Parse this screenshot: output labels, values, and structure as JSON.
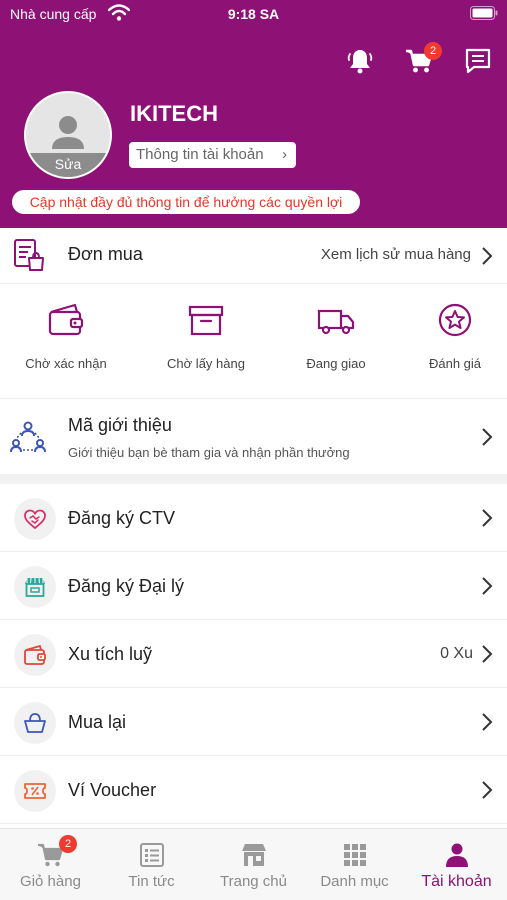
{
  "status_bar": {
    "carrier": "Nhà cung cấp",
    "time": "9:18 SA"
  },
  "header": {
    "icons": [
      "bell-icon",
      "cart-icon",
      "chat-icon"
    ],
    "cart_badge": "2",
    "user_name": "IKITECH",
    "avatar_edit_label": "Sửa",
    "account_info_label": "Thông tin tài khoản",
    "update_notice": "Cập nhật đầy đủ thông tin để hưởng các quyền lợi",
    "background_color": "#8e1276"
  },
  "orders": {
    "title": "Đơn mua",
    "history_link": "Xem lịch sử mua hàng",
    "statuses": [
      {
        "label": "Chờ xác nhận",
        "icon": "wallet-icon"
      },
      {
        "label": "Chờ lấy hàng",
        "icon": "box-icon"
      },
      {
        "label": "Đang giao",
        "icon": "truck-icon"
      },
      {
        "label": "Đánh giá",
        "icon": "star-icon"
      }
    ]
  },
  "referral": {
    "title": "Mã giới thiệu",
    "description": "Giới thiệu bạn bè tham gia và nhận phần thưởng"
  },
  "menu": [
    {
      "label": "Đăng ký CTV",
      "icon": "handshake-heart-icon",
      "value": ""
    },
    {
      "label": "Đăng ký Đại lý",
      "icon": "store-icon",
      "value": ""
    },
    {
      "label": "Xu tích luỹ",
      "icon": "coin-wallet-icon",
      "value": "0 Xu"
    },
    {
      "label": "Mua lại",
      "icon": "bag-icon",
      "value": ""
    },
    {
      "label": "Ví Voucher",
      "icon": "voucher-icon",
      "value": ""
    }
  ],
  "tabbar": {
    "cart_badge": "2",
    "active": "Tài khoản",
    "tabs": [
      {
        "label": "Giỏ hàng",
        "icon": "cart-icon"
      },
      {
        "label": "Tin tức",
        "icon": "news-icon"
      },
      {
        "label": "Trang chủ",
        "icon": "storefront-icon"
      },
      {
        "label": "Danh mục",
        "icon": "grid-icon"
      },
      {
        "label": "Tài khoản",
        "icon": "user-icon"
      }
    ]
  },
  "colors": {
    "accent": "#8e1276",
    "badge": "#ef3b2f",
    "warning_text": "#e6362b"
  }
}
